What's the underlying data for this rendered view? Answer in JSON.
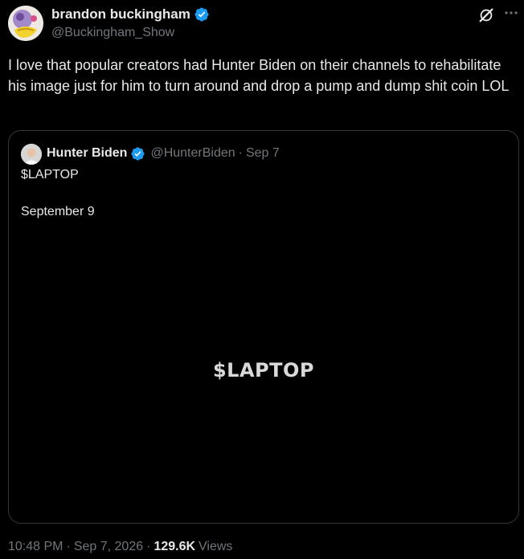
{
  "author": {
    "display_name": "brandon buckingham",
    "handle": "@Buckingham_Show",
    "verified": true
  },
  "tweet": {
    "text": "I love that popular creators had Hunter Biden on their channels to rehabilitate his image just for him to turn around and drop a pump and dump shit coin LOL"
  },
  "quote": {
    "display_name": "Hunter Biden",
    "handle": "@HunterBiden",
    "separator": "·",
    "date": "Sep 7",
    "line1": "$LAPTOP",
    "line2": "September 9",
    "media_text": "$LAPTOP"
  },
  "meta": {
    "time": "10:48 PM",
    "separator": "·",
    "date": "Sep 7, 2026",
    "views_count": "129.6K",
    "views_label": "Views"
  },
  "icons": {
    "verified": "verified-badge-icon",
    "grok": "grok-icon",
    "more": "more-options-icon"
  },
  "colors": {
    "background": "#000000",
    "text": "#e7e9ea",
    "secondary": "#71767b",
    "verified": "#1d9bf0",
    "border": "#333639"
  }
}
